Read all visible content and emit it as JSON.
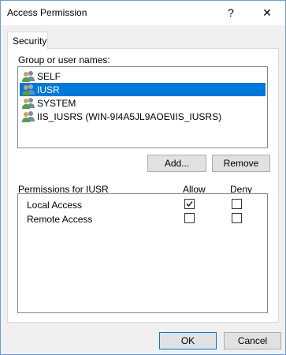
{
  "window": {
    "title": "Access Permission"
  },
  "titlebar": {
    "help": "?",
    "close": "✕"
  },
  "tab": {
    "label": "Security"
  },
  "groups": {
    "label": "Group or user names:",
    "users": [
      {
        "name": "SELF",
        "selected": false
      },
      {
        "name": "IUSR",
        "selected": true
      },
      {
        "name": "SYSTEM",
        "selected": false
      },
      {
        "name": "IIS_IUSRS (WIN-9I4A5JL9AOE\\IIS_IUSRS)",
        "selected": false
      }
    ],
    "add": "Add...",
    "remove": "Remove"
  },
  "permissions": {
    "label": "Permissions for IUSR",
    "allow_header": "Allow",
    "deny_header": "Deny",
    "rows": [
      {
        "name": "Local Access",
        "allow": true,
        "deny": false
      },
      {
        "name": "Remote Access",
        "allow": false,
        "deny": false
      }
    ]
  },
  "footer": {
    "ok": "OK",
    "cancel": "Cancel"
  }
}
